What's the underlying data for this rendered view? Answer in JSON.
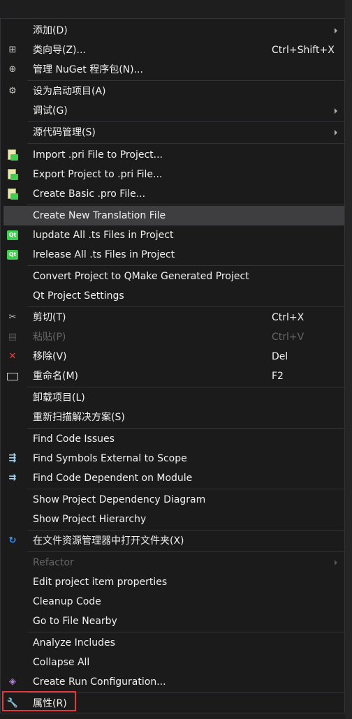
{
  "menu": {
    "items": [
      {
        "label": "添加(D)",
        "shortcut": "",
        "icon": "",
        "submenu": true,
        "disabled": false
      },
      {
        "label": "类向导(Z)...",
        "shortcut": "Ctrl+Shift+X",
        "icon": "class-wizard-icon",
        "submenu": false,
        "disabled": false
      },
      {
        "label": "管理 NuGet 程序包(N)...",
        "shortcut": "",
        "icon": "nuget-package-icon",
        "submenu": false,
        "disabled": false
      },
      {
        "label": "设为启动项目(A)",
        "shortcut": "",
        "icon": "gear-icon",
        "submenu": false,
        "disabled": false
      },
      {
        "label": "调试(G)",
        "shortcut": "",
        "icon": "",
        "submenu": true,
        "disabled": false
      },
      {
        "label": "源代码管理(S)",
        "shortcut": "",
        "icon": "",
        "submenu": true,
        "disabled": false
      },
      {
        "label": "Import .pri File to Project...",
        "shortcut": "",
        "icon": "import-pri-icon",
        "submenu": false,
        "disabled": false
      },
      {
        "label": "Export Project to .pri File...",
        "shortcut": "",
        "icon": "export-pri-icon",
        "submenu": false,
        "disabled": false
      },
      {
        "label": "Create Basic .pro File...",
        "shortcut": "",
        "icon": "create-pro-icon",
        "submenu": false,
        "disabled": false
      },
      {
        "label": "Create New Translation File",
        "shortcut": "",
        "icon": "",
        "submenu": false,
        "disabled": false,
        "highlighted": true
      },
      {
        "label": "lupdate All .ts Files in Project",
        "shortcut": "",
        "icon": "qt-icon",
        "submenu": false,
        "disabled": false
      },
      {
        "label": "lrelease All .ts Files in Project",
        "shortcut": "",
        "icon": "qt-icon",
        "submenu": false,
        "disabled": false
      },
      {
        "label": "Convert Project to QMake Generated Project",
        "shortcut": "",
        "icon": "",
        "submenu": false,
        "disabled": false
      },
      {
        "label": "Qt Project Settings",
        "shortcut": "",
        "icon": "",
        "submenu": false,
        "disabled": false
      },
      {
        "label": "剪切(T)",
        "shortcut": "Ctrl+X",
        "icon": "scissors-icon",
        "submenu": false,
        "disabled": false
      },
      {
        "label": "粘贴(P)",
        "shortcut": "Ctrl+V",
        "icon": "paste-icon",
        "submenu": false,
        "disabled": true
      },
      {
        "label": "移除(V)",
        "shortcut": "Del",
        "icon": "remove-x-icon",
        "submenu": false,
        "disabled": false
      },
      {
        "label": "重命名(M)",
        "shortcut": "F2",
        "icon": "rename-icon",
        "submenu": false,
        "disabled": false
      },
      {
        "label": "卸载项目(L)",
        "shortcut": "",
        "icon": "",
        "submenu": false,
        "disabled": false
      },
      {
        "label": "重新扫描解决方案(S)",
        "shortcut": "",
        "icon": "",
        "submenu": false,
        "disabled": false
      },
      {
        "label": "Find Code Issues",
        "shortcut": "",
        "icon": "",
        "submenu": false,
        "disabled": false
      },
      {
        "label": "Find Symbols External to Scope",
        "shortcut": "",
        "icon": "find-symbols-icon",
        "submenu": false,
        "disabled": false
      },
      {
        "label": "Find Code Dependent on Module",
        "shortcut": "",
        "icon": "find-dependent-icon",
        "submenu": false,
        "disabled": false
      },
      {
        "label": "Show Project Dependency Diagram",
        "shortcut": "",
        "icon": "",
        "submenu": false,
        "disabled": false
      },
      {
        "label": "Show Project Hierarchy",
        "shortcut": "",
        "icon": "",
        "submenu": false,
        "disabled": false
      },
      {
        "label": "在文件资源管理器中打开文件夹(X)",
        "shortcut": "",
        "icon": "refresh-arrow-icon",
        "submenu": false,
        "disabled": false
      },
      {
        "label": "Refactor",
        "shortcut": "",
        "icon": "",
        "submenu": true,
        "disabled": true
      },
      {
        "label": "Edit project item properties",
        "shortcut": "",
        "icon": "",
        "submenu": false,
        "disabled": false
      },
      {
        "label": "Cleanup Code",
        "shortcut": "",
        "icon": "",
        "submenu": false,
        "disabled": false
      },
      {
        "label": "Go to File Nearby",
        "shortcut": "",
        "icon": "",
        "submenu": false,
        "disabled": false
      },
      {
        "label": "Analyze Includes",
        "shortcut": "",
        "icon": "",
        "submenu": false,
        "disabled": false
      },
      {
        "label": "Collapse All",
        "shortcut": "",
        "icon": "",
        "submenu": false,
        "disabled": false
      },
      {
        "label": "Create Run Configuration...",
        "shortcut": "",
        "icon": "run-config-icon",
        "submenu": false,
        "disabled": false
      },
      {
        "label": "属性(R)",
        "shortcut": "",
        "icon": "wrench-icon",
        "submenu": false,
        "disabled": false,
        "boxed": true
      }
    ]
  },
  "colors": {
    "background": "#1b1b1c",
    "highlight": "#3e3e40",
    "text": "#f1f1f1",
    "disabled_text": "#656565",
    "focus_box": "#e0393e",
    "qt_green": "#41cd52"
  }
}
